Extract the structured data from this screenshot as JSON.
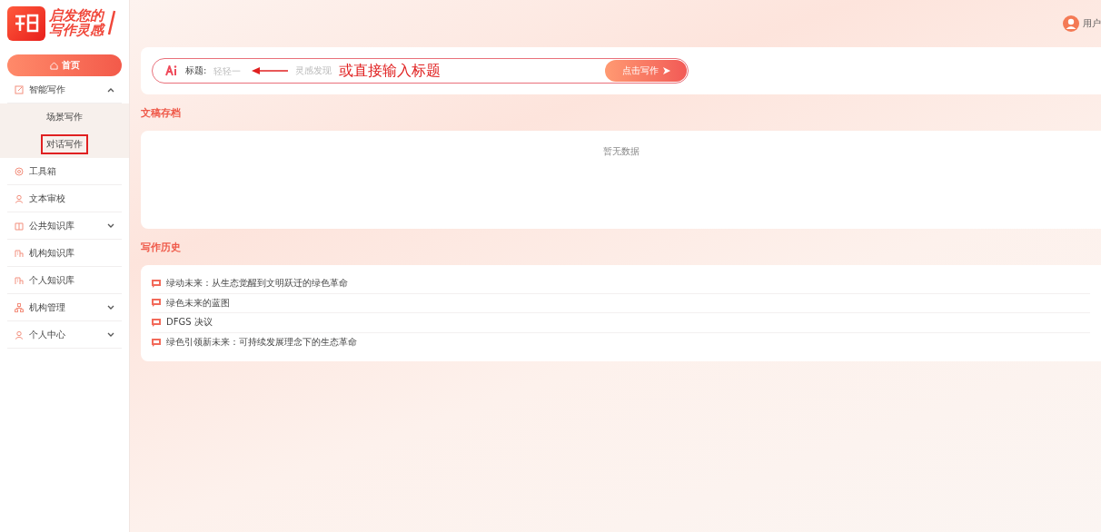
{
  "logo": {
    "line_1": "启发您的",
    "line_2": "写作灵感"
  },
  "sidebar": {
    "items": [
      {
        "kind": "home",
        "label": "首页",
        "selected": true
      },
      {
        "kind": "group",
        "label": "智能写作",
        "expanded": true,
        "children": [
          {
            "label": "场景写作",
            "highlighted": false
          },
          {
            "label": "对话写作",
            "highlighted": true
          }
        ]
      },
      {
        "kind": "item",
        "label": "工具箱"
      },
      {
        "kind": "item",
        "label": "文本审校"
      },
      {
        "kind": "group",
        "label": "公共知识库",
        "expanded": false
      },
      {
        "kind": "item",
        "label": "机构知识库"
      },
      {
        "kind": "item",
        "label": "个人知识库"
      },
      {
        "kind": "group",
        "label": "机构管理",
        "expanded": false
      },
      {
        "kind": "group",
        "label": "个人中心",
        "expanded": false
      }
    ]
  },
  "header": {
    "user": "用户"
  },
  "title_bar": {
    "label": "标题:",
    "placeholder": "轻轻一",
    "placeholder_rest": "灵感发现",
    "button": "点击写作",
    "annotation": "或直接输入标题"
  },
  "archive": {
    "title": "文稿存档",
    "empty": "暂无数据"
  },
  "history": {
    "title": "写作历史",
    "items": [
      "绿动未来：从生态觉醒到文明跃迁的绿色革命",
      "绿色未来的蓝图",
      "DFGS 决议",
      "绿色引领新未来：可持续发展理念下的生态革命"
    ]
  }
}
